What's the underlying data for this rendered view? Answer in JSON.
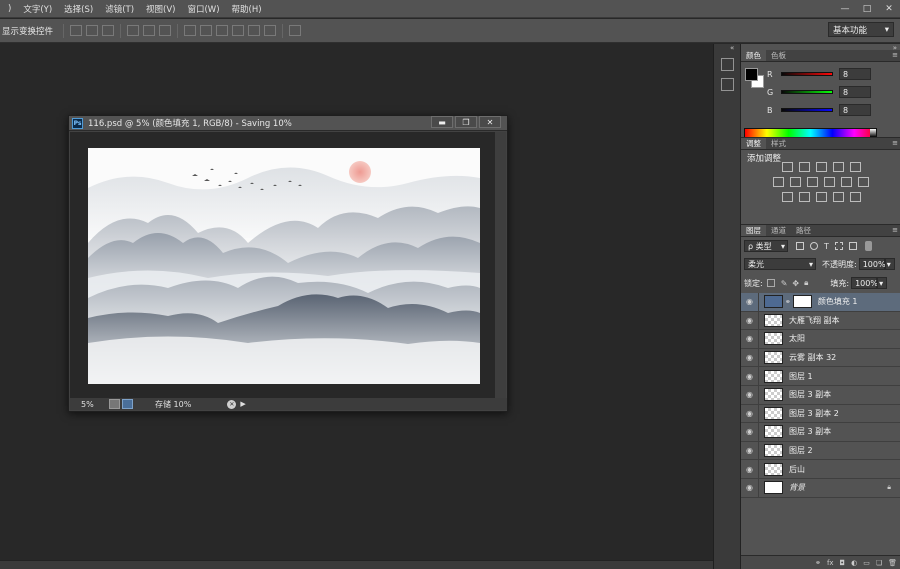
{
  "menubar": {
    "items": [
      ")",
      "文字(Y)",
      "选择(S)",
      "滤镜(T)",
      "视图(V)",
      "窗口(W)",
      "帮助(H)"
    ],
    "window_controls": [
      "—",
      "□",
      "✕"
    ]
  },
  "options_bar": {
    "label": "显示变换控件",
    "workspace": "基本功能",
    "workspace_arrow": "▾"
  },
  "document": {
    "title": "116.psd @ 5% (颜色填充 1, RGB/8) - Saving 10%",
    "ps_icon": "Ps",
    "buttons": [
      "▬",
      "❐",
      "✕"
    ],
    "zoom": "5%",
    "status": "存储 10%",
    "status_icon": "cancel-icon",
    "status_arrow": "▶"
  },
  "panels": {
    "color": {
      "tabs": [
        "颜色",
        "色板"
      ],
      "channels": [
        {
          "label": "R",
          "value": "8",
          "color": "#d92b2b"
        },
        {
          "label": "G",
          "value": "8",
          "color": "#2bb32b"
        },
        {
          "label": "B",
          "value": "8",
          "color": "#2b2bd9"
        }
      ]
    },
    "adjustments": {
      "tabs": [
        "调整",
        "样式"
      ],
      "heading": "添加调整"
    },
    "layers": {
      "tabs": [
        "图层",
        "通道",
        "路径"
      ],
      "filter_kind": "ρ 类型",
      "blend_mode": "柔光",
      "opacity_label": "不透明度:",
      "opacity_value": "100%",
      "lock_label": "锁定:",
      "fill_label": "填充:",
      "fill_value": "100%",
      "items": [
        {
          "name": "颜色填充 1",
          "selected": true
        },
        {
          "name": "大雁飞翔 副本"
        },
        {
          "name": "太阳"
        },
        {
          "name": "云雾 副本 32"
        },
        {
          "name": "图层 1"
        },
        {
          "name": "图层 3 副本"
        },
        {
          "name": "图层 3 副本 2"
        },
        {
          "name": "图层 3 副本"
        },
        {
          "name": "图层 2"
        },
        {
          "name": "后山"
        },
        {
          "name": "背景",
          "locked": true
        }
      ],
      "footer_icons": [
        "link-icon",
        "fx-icon",
        "mask-icon",
        "adjustment-icon",
        "folder-icon",
        "new-layer-icon",
        "trash-icon"
      ],
      "footer_glyphs": [
        "⚭",
        "fx",
        "◘",
        "◐",
        "▭",
        "❏",
        "🗑"
      ]
    }
  }
}
